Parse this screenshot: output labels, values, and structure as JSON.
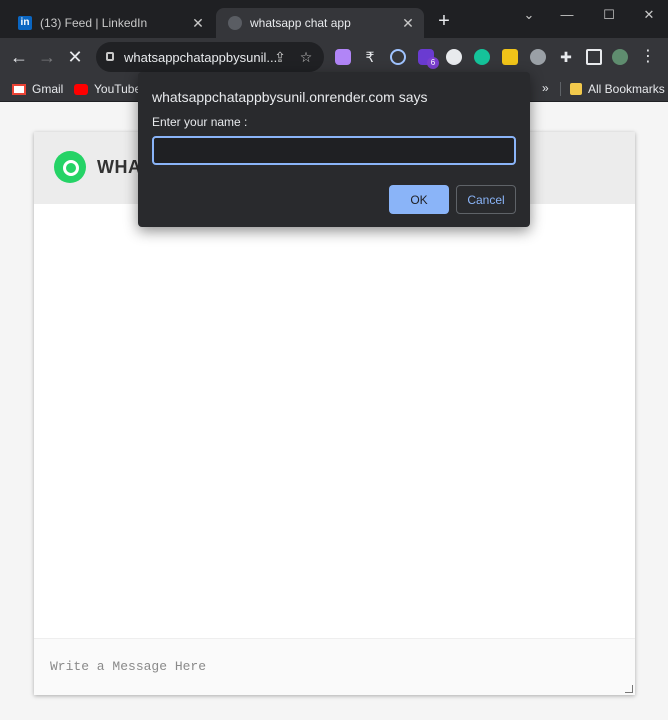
{
  "browser": {
    "tabs": [
      {
        "title": "(13) Feed | LinkedIn",
        "favicon": "linkedin-icon",
        "active": false
      },
      {
        "title": "whatsapp chat app",
        "favicon": "loading-globe-icon",
        "active": true
      }
    ],
    "close_glyph": "✕",
    "new_tab_glyph": "+",
    "window_controls": {
      "tab_search": "⌄",
      "minimize": "—",
      "maximize": "☐",
      "close": "✕"
    },
    "nav": {
      "back": "←",
      "forward": "→",
      "stop": "✕"
    },
    "address_bar": {
      "url": "whatsappchatappbysunil..."
    },
    "extensions_badge": "6",
    "menu_glyph": "⋮",
    "bookmarks": [
      {
        "label": "Gmail",
        "icon": "gmail-icon"
      },
      {
        "label": "YouTube",
        "icon": "youtube-icon"
      }
    ],
    "bookmarks_overflow": "»",
    "all_bookmarks_label": "All Bookmarks"
  },
  "page": {
    "header_title": "WHATSAPP",
    "message_placeholder": "Write a Message Here"
  },
  "dialog": {
    "title": "whatsappchatappbysunil.onrender.com says",
    "label": "Enter your name :",
    "input_value": "",
    "ok_label": "OK",
    "cancel_label": "Cancel"
  },
  "colors": {
    "accent": "#8ab4f8",
    "whatsapp_green": "#25d366",
    "chrome_dark": "#35363a"
  }
}
